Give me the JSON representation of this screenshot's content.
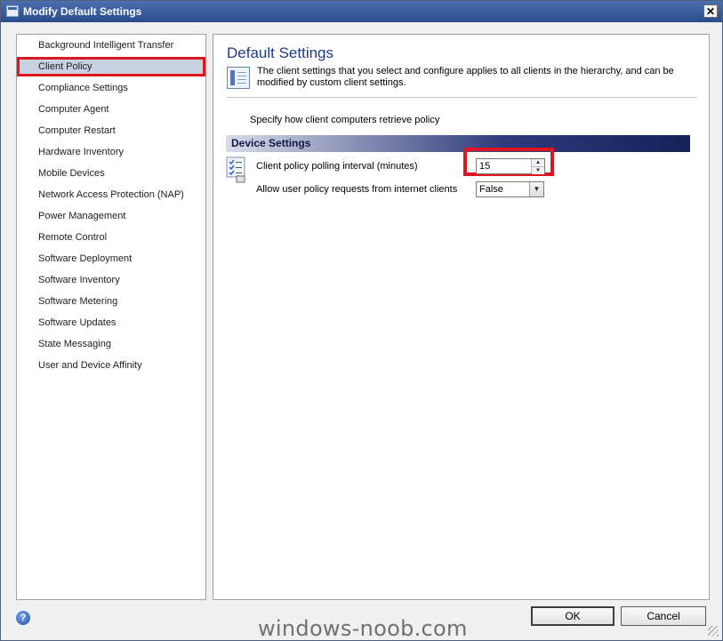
{
  "window": {
    "title": "Modify Default Settings",
    "close_glyph": "✕"
  },
  "nav": {
    "items": [
      {
        "label": "Background Intelligent Transfer",
        "selected": false
      },
      {
        "label": "Client Policy",
        "selected": true
      },
      {
        "label": "Compliance Settings",
        "selected": false
      },
      {
        "label": "Computer Agent",
        "selected": false
      },
      {
        "label": "Computer Restart",
        "selected": false
      },
      {
        "label": "Hardware Inventory",
        "selected": false
      },
      {
        "label": "Mobile Devices",
        "selected": false
      },
      {
        "label": "Network Access Protection (NAP)",
        "selected": false
      },
      {
        "label": "Power Management",
        "selected": false
      },
      {
        "label": "Remote Control",
        "selected": false
      },
      {
        "label": "Software Deployment",
        "selected": false
      },
      {
        "label": "Software Inventory",
        "selected": false
      },
      {
        "label": "Software Metering",
        "selected": false
      },
      {
        "label": "Software Updates",
        "selected": false
      },
      {
        "label": "State Messaging",
        "selected": false
      },
      {
        "label": "User and Device Affinity",
        "selected": false
      }
    ]
  },
  "content": {
    "title": "Default Settings",
    "description": "The client settings that you select and configure applies to all clients in the hierarchy, and can be modified by custom client settings.",
    "subheading": "Specify how client computers retrieve policy",
    "section_header": "Device Settings",
    "settings": {
      "polling_label": "Client policy polling interval (minutes)",
      "polling_value": "15",
      "user_policy_label": "Allow user policy requests from internet clients",
      "user_policy_value": "False"
    }
  },
  "footer": {
    "ok_label": "OK",
    "cancel_label": "Cancel",
    "help_glyph": "?"
  },
  "watermark": "windows-noob.com",
  "colors": {
    "highlight": "#e0161e",
    "title_bar": "#2a4c8c",
    "heading": "#1f3a87"
  },
  "icons": [
    "window-icon",
    "close-icon",
    "settings-page-icon",
    "checklist-icon",
    "help-icon",
    "spin-up-icon",
    "spin-down-icon",
    "dropdown-arrow-icon"
  ]
}
